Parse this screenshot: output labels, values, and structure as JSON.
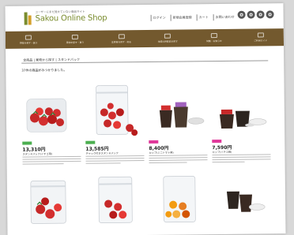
{
  "header": {
    "logo_sub": "ユーザーにまだ見せていない商品サイト",
    "logo_main": "Sakou Online Shop",
    "util": [
      "ログイン",
      "新規会員登録",
      "カート",
      "お問い合わせ"
    ],
    "icons": [
      "search-icon",
      "user-icon",
      "cart-icon",
      "help-icon"
    ]
  },
  "nav": [
    "野菜を探す・買う",
    "果物を探す・買う",
    "生産者を探す・知る",
    "地域の特産品を探す",
    "特集・お知らせ",
    "ご利用ガイド"
  ],
  "breadcrumb": "全商品 | 果物から探す | スタンドパック",
  "result_text": "37件の商品がみつかりました。",
  "products": [
    {
      "tag_color": "#4caf50",
      "price": "13,310円",
      "name": "スタンドパック(イチゴ用)",
      "image": "strawberry-pack"
    },
    {
      "tag_color": "#4caf50",
      "price": "13,585円",
      "name": "チャック付きスタンドパック",
      "image": "strawberry-zip-bag"
    },
    {
      "tag_color": "#e0389a",
      "price": "8,400円",
      "name": "カップ(ミニトマト用)",
      "image": "cups"
    },
    {
      "tag_color": "#e0389a",
      "price": "7,590円",
      "name": "カップ(イチゴ用)",
      "image": "lid-cups"
    },
    {
      "image": "tomato-pack"
    },
    {
      "image": "strawberry-bag"
    },
    {
      "image": "orange-bag"
    },
    {
      "image": "dark-cups"
    }
  ]
}
